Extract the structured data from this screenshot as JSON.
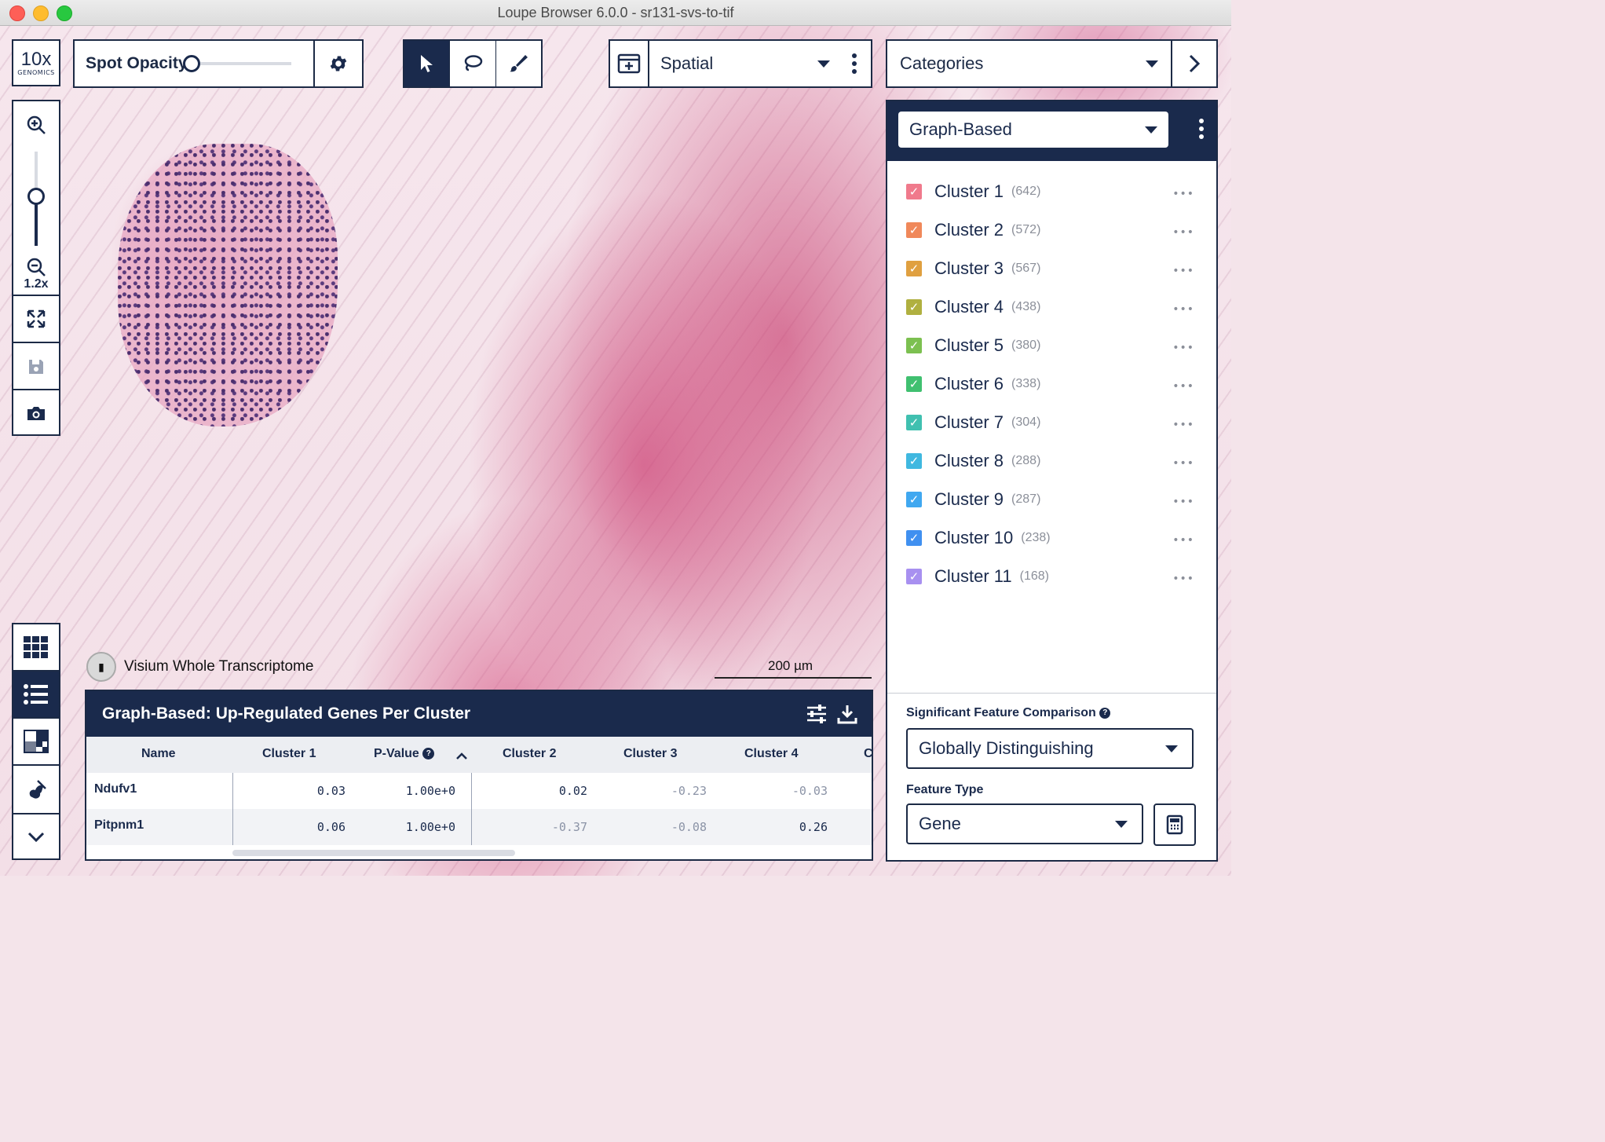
{
  "window": {
    "title": "Loupe Browser 6.0.0 - sr131-svs-to-tif"
  },
  "logo": {
    "line1": "10x",
    "line2": "GENOMICS"
  },
  "toolbar": {
    "spot_opacity_label": "Spot Opacity",
    "spot_opacity_value": 0.0,
    "view_select": "Spatial",
    "category_select": "Categories"
  },
  "zoom": {
    "level": "1.2x"
  },
  "overlay": {
    "assay_label": "Visium Whole Transcriptome",
    "scale_bar": "200 µm"
  },
  "side_panel": {
    "clustering": "Graph-Based",
    "clusters": [
      {
        "name": "Cluster 1",
        "count": "(642)",
        "color": "#f07a8c"
      },
      {
        "name": "Cluster 2",
        "count": "(572)",
        "color": "#f0885a"
      },
      {
        "name": "Cluster 3",
        "count": "(567)",
        "color": "#e0a040"
      },
      {
        "name": "Cluster 4",
        "count": "(438)",
        "color": "#b0b040"
      },
      {
        "name": "Cluster 5",
        "count": "(380)",
        "color": "#7cc050"
      },
      {
        "name": "Cluster 6",
        "count": "(338)",
        "color": "#40c070"
      },
      {
        "name": "Cluster 7",
        "count": "(304)",
        "color": "#40c0b0"
      },
      {
        "name": "Cluster 8",
        "count": "(288)",
        "color": "#40b8e0"
      },
      {
        "name": "Cluster 9",
        "count": "(287)",
        "color": "#40a8f0"
      },
      {
        "name": "Cluster 10",
        "count": "(238)",
        "color": "#4090f0"
      },
      {
        "name": "Cluster 11",
        "count": "(168)",
        "color": "#a890f0"
      }
    ],
    "more_glyph": "•••",
    "comparison_label": "Significant Feature Comparison",
    "comparison_value": "Globally Distinguishing",
    "feature_type_label": "Feature Type",
    "feature_type_value": "Gene"
  },
  "table": {
    "title": "Graph-Based: Up-Regulated Genes Per Cluster",
    "columns": [
      "Name",
      "Cluster 1",
      "P-Value",
      "Cluster 2",
      "Cluster 3",
      "Cluster 4",
      "C"
    ],
    "rows": [
      {
        "name": "Ndufv1",
        "c1": "0.03",
        "p": "1.00e+0",
        "c2": "0.02",
        "c3": "-0.23",
        "c4": "-0.03"
      },
      {
        "name": "Pitpnm1",
        "c1": "0.06",
        "p": "1.00e+0",
        "c2": "-0.37",
        "c3": "-0.08",
        "c4": "0.26"
      }
    ]
  },
  "colors": {
    "navy": "#1a2a4c",
    "negative_value": "#8b93a6"
  }
}
